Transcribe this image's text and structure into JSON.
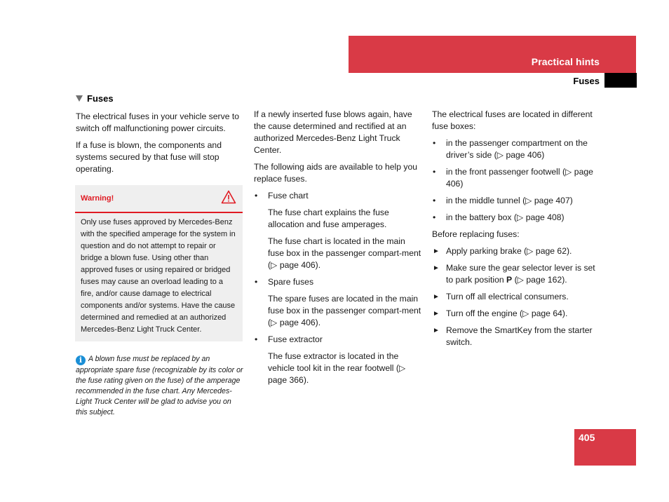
{
  "header": {
    "chapter_title": "Practical hints",
    "section_label": "Fuses",
    "accent_color": "#d93a46"
  },
  "col1": {
    "heading_icon": "triangle-down-icon",
    "heading": "Fuses",
    "para1": "The electrical fuses in your vehicle serve to switch off malfunctioning power circuits.",
    "para2": "If a fuse is blown, the components and systems secured by that fuse will stop operating.",
    "warning": {
      "title": "Warning!",
      "icon": "warning-triangle-icon",
      "color": "#e01a22",
      "text": "Only use fuses approved by Mercedes-Benz with the specified amperage for the system in question and do not attempt to repair or bridge a blown fuse. Using other than approved fuses or using repaired or bridged fuses may cause an overload leading to a fire, and/or cause damage to electrical components and/or systems. Have the cause determined and remedied at an authorized Mercedes-Benz Light Truck Center."
    },
    "note": {
      "icon": "info-icon",
      "icon_glyph": "i",
      "text": "A blown fuse must be replaced by an appropriate spare fuse (recognizable by its color or the fuse rating given on the fuse) of the amperage recommended in the fuse chart. Any Mercedes-Light Truck Center will be glad to advise you on this subject."
    }
  },
  "col2": {
    "para1": "If a newly inserted fuse blows again, have the cause determined and rectified at an authorized Mercedes-Benz Light Truck Center.",
    "para2": "The following aids are available to help you replace fuses.",
    "bullet_glyph": "•",
    "items": [
      {
        "label": "Fuse chart",
        "sub": [
          "The fuse chart explains the fuse allocation and fuse amperages.",
          "The fuse chart is located in the main fuse box in the passenger compart-ment (▷ page 406)."
        ]
      },
      {
        "label": "Spare fuses",
        "sub": [
          "The spare fuses are located in the main fuse box in the passenger compart-ment (▷ page 406)."
        ]
      },
      {
        "label": "Fuse extractor",
        "sub": [
          "The fuse extractor is located in the vehicle tool kit in the rear footwell (▷ page 366)."
        ]
      }
    ]
  },
  "col3": {
    "para1": "The electrical fuses are located in different fuse boxes:",
    "bullet_glyph": "•",
    "locations": [
      "in the passenger compartment on the driver’s side (▷ page 406)",
      "in the front passenger footwell (▷ page 406)",
      "in the middle tunnel (▷ page 407)",
      "in the battery box (▷ page 408)"
    ],
    "before_label": "Before replacing fuses:",
    "step_glyph": "►",
    "steps": [
      {
        "pre": "Apply parking brake (▷ page 62).",
        "bold": "",
        "post": ""
      },
      {
        "pre": "Make sure the gear selector lever is set to park position ",
        "bold": "P",
        "post": " (▷ page 162)."
      },
      {
        "pre": "Turn off all electrical consumers.",
        "bold": "",
        "post": ""
      },
      {
        "pre": "Turn off the engine (▷ page 64).",
        "bold": "",
        "post": ""
      },
      {
        "pre": "Remove the SmartKey from the starter switch.",
        "bold": "",
        "post": ""
      }
    ]
  },
  "footer": {
    "page_number": "405"
  }
}
